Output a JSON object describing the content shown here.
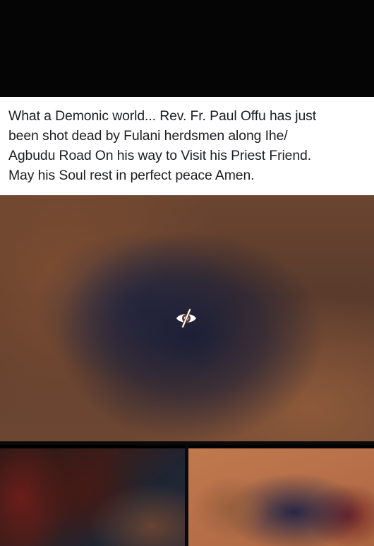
{
  "post": {
    "text_line_1": "What a Demonic world... Rev. Fr. Paul Offu has just",
    "text_line_2": "been shot dead by Fulani herdsmen along  Ihe/",
    "text_line_3": "Agbudu Road On his way to Visit his Priest Friend.",
    "text_line_4": "May his Soul rest in perfect peace Amen."
  },
  "media": {
    "main_icon": "eye-slash-icon",
    "thumbnails": [
      "thumbnail-left",
      "thumbnail-right"
    ]
  }
}
